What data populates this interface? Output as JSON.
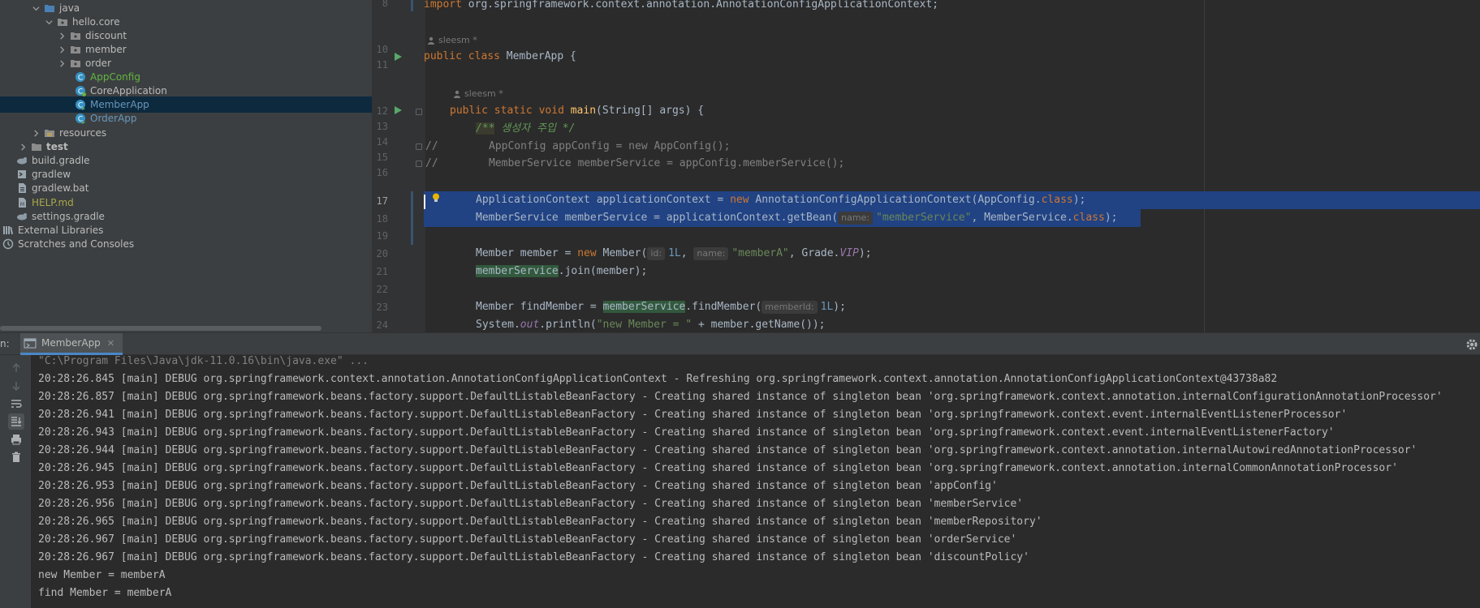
{
  "project_tree": {
    "items": [
      {
        "label": "java",
        "expanded": true,
        "icon": "folder-icon"
      },
      {
        "label": "hello.core",
        "expanded": true,
        "icon": "package-icon"
      },
      {
        "label": "discount",
        "expanded": false,
        "icon": "package-icon"
      },
      {
        "label": "member",
        "expanded": false,
        "icon": "package-icon"
      },
      {
        "label": "order",
        "expanded": false,
        "icon": "package-icon"
      },
      {
        "label": "AppConfig",
        "icon": "class-icon"
      },
      {
        "label": "CoreApplication",
        "icon": "spring-class-icon"
      },
      {
        "label": "MemberApp",
        "icon": "class-icon",
        "selected": true
      },
      {
        "label": "OrderApp",
        "icon": "class-icon"
      },
      {
        "label": "resources",
        "expanded": false,
        "icon": "folder-icon"
      },
      {
        "label": "test",
        "expanded": false,
        "icon": "folder-icon"
      },
      {
        "label": "build.gradle",
        "icon": "gradle-icon"
      },
      {
        "label": "gradlew",
        "icon": "terminal-file-icon"
      },
      {
        "label": "gradlew.bat",
        "icon": "text-file-icon"
      },
      {
        "label": "HELP.md",
        "icon": "markdown-icon"
      },
      {
        "label": "settings.gradle",
        "icon": "gradle-icon"
      },
      {
        "label": "External Libraries",
        "icon": "library-icon"
      },
      {
        "label": "Scratches and Consoles",
        "icon": "scratch-icon"
      }
    ]
  },
  "editor": {
    "line_numbers": [
      "8",
      "10",
      "11",
      "12",
      "13",
      "14",
      "15",
      "16",
      "17",
      "18",
      "19",
      "20",
      "21",
      "22",
      "23",
      "24"
    ],
    "authors": {
      "class_author": "sleesm *",
      "method_author": "sleesm *"
    },
    "line8": {
      "kw": "import",
      "text": " org.springframework.context.annotation.AnnotationConfigApplicationContext;"
    },
    "line10": {
      "kw1": "public",
      "kw2": " class",
      "text": " MemberApp {"
    },
    "line12": {
      "kw1": "public",
      "kw2": " static",
      "kw3": " void",
      "fn": " main",
      "text": "(String[] args) {"
    },
    "line13": {
      "open": "/**",
      "text": " 생성자 주입 */"
    },
    "line14": {
      "text": "AppConfig appConfig = new AppConfig();"
    },
    "line15": {
      "text": "MemberService memberService = appConfig.memberService();"
    },
    "line17": {
      "a": "ApplicationContext applicationContext = ",
      "kw": "new",
      "b": " AnnotationConfigApplicationContext(AppConfig.",
      "kw2": "class",
      "c": ");"
    },
    "line18": {
      "a": "MemberService memberService = applicationContext.getBean(",
      "hint": "name:",
      "str": "\"memberService\"",
      "b": ", MemberService.",
      "kw": "class",
      "c": ");"
    },
    "line20": {
      "a": "Member member = ",
      "kw": "new",
      "b": " Member(",
      "hint1": "id:",
      "num": "1L",
      "c": ", ",
      "hint2": "name:",
      "str": "\"memberA\"",
      "d": ", Grade.",
      "st": "VIP",
      "e": ");"
    },
    "line21": {
      "var": "memberService",
      "text": ".join(member);"
    },
    "line23": {
      "a": "Member findMember = ",
      "var": "memberService",
      "b": ".findMember(",
      "hint": "memberId:",
      "num": "1L",
      "c": ");"
    },
    "line24": {
      "a": "System.",
      "st": "out",
      "b": ".println(",
      "str": "\"new Member = \"",
      "c": " + member.getName());"
    }
  },
  "run_panel": {
    "prefix": "n:",
    "tab_label": "MemberApp",
    "console_lines": [
      "\"C:\\Program Files\\Java\\jdk-11.0.16\\bin\\java.exe\" ...",
      "20:28:26.845 [main] DEBUG org.springframework.context.annotation.AnnotationConfigApplicationContext - Refreshing org.springframework.context.annotation.AnnotationConfigApplicationContext@43738a82",
      "20:28:26.857 [main] DEBUG org.springframework.beans.factory.support.DefaultListableBeanFactory - Creating shared instance of singleton bean 'org.springframework.context.annotation.internalConfigurationAnnotationProcessor'",
      "20:28:26.941 [main] DEBUG org.springframework.beans.factory.support.DefaultListableBeanFactory - Creating shared instance of singleton bean 'org.springframework.context.event.internalEventListenerProcessor'",
      "20:28:26.943 [main] DEBUG org.springframework.beans.factory.support.DefaultListableBeanFactory - Creating shared instance of singleton bean 'org.springframework.context.event.internalEventListenerFactory'",
      "20:28:26.944 [main] DEBUG org.springframework.beans.factory.support.DefaultListableBeanFactory - Creating shared instance of singleton bean 'org.springframework.context.annotation.internalAutowiredAnnotationProcessor'",
      "20:28:26.945 [main] DEBUG org.springframework.beans.factory.support.DefaultListableBeanFactory - Creating shared instance of singleton bean 'org.springframework.context.annotation.internalCommonAnnotationProcessor'",
      "20:28:26.953 [main] DEBUG org.springframework.beans.factory.support.DefaultListableBeanFactory - Creating shared instance of singleton bean 'appConfig'",
      "20:28:26.956 [main] DEBUG org.springframework.beans.factory.support.DefaultListableBeanFactory - Creating shared instance of singleton bean 'memberService'",
      "20:28:26.965 [main] DEBUG org.springframework.beans.factory.support.DefaultListableBeanFactory - Creating shared instance of singleton bean 'memberRepository'",
      "20:28:26.967 [main] DEBUG org.springframework.beans.factory.support.DefaultListableBeanFactory - Creating shared instance of singleton bean 'orderService'",
      "20:28:26.967 [main] DEBUG org.springframework.beans.factory.support.DefaultListableBeanFactory - Creating shared instance of singleton bean 'discountPolicy'",
      "new Member = memberA",
      "find Member = memberA"
    ]
  }
}
